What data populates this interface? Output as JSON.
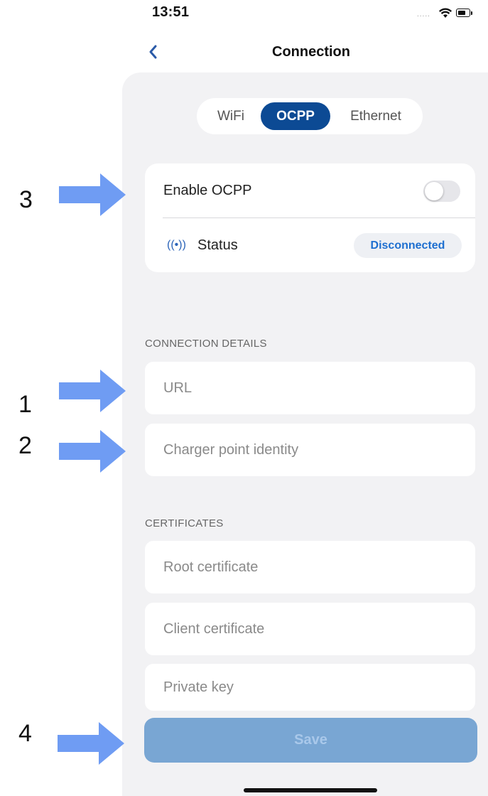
{
  "status_bar": {
    "time": "13:51",
    "signal": "....."
  },
  "nav": {
    "title": "Connection",
    "back_icon": "chevron-left-icon"
  },
  "tabs": [
    {
      "label": "WiFi",
      "selected": false
    },
    {
      "label": "OCPP",
      "selected": true
    },
    {
      "label": "Ethernet",
      "selected": false
    }
  ],
  "ocpp_card": {
    "enable_label": "Enable OCPP",
    "enabled": false,
    "status_icon": "((•))",
    "status_label": "Status",
    "status_value": "Disconnected"
  },
  "connection_details": {
    "header": "CONNECTION DETAILS",
    "url_placeholder": "URL",
    "url_value": "",
    "charger_id_placeholder": "Charger point identity",
    "charger_id_value": ""
  },
  "certificates": {
    "header": "CERTIFICATES",
    "root_placeholder": "Root certificate",
    "client_placeholder": "Client certificate",
    "key_placeholder": "Private key"
  },
  "save_label": "Save",
  "annotations": {
    "a1": "1",
    "a2": "2",
    "a3": "3",
    "a4": "4"
  },
  "colors": {
    "accent": "#0c4a94",
    "save_disabled": "#79a6d3",
    "annotation_arrow": "#6f9cf3",
    "panel_bg": "#f2f2f4"
  }
}
